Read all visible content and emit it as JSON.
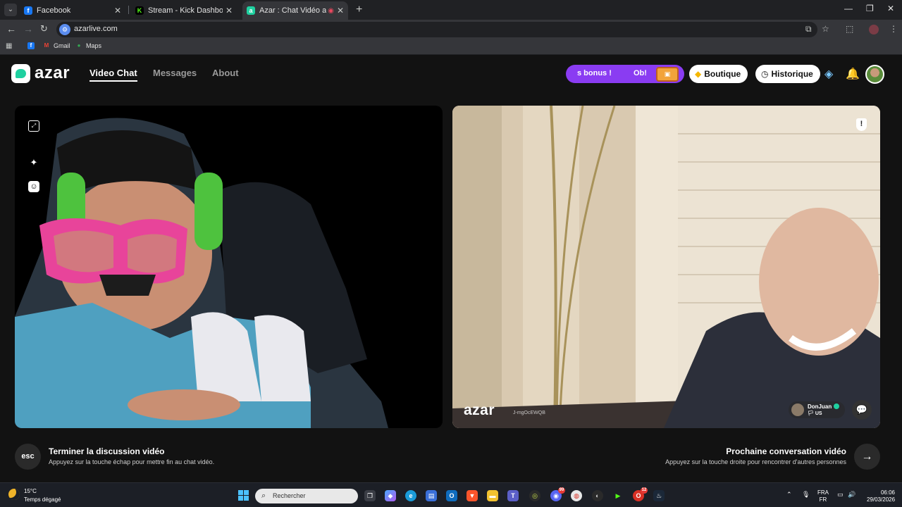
{
  "browser": {
    "tabs": [
      {
        "title": "Facebook",
        "icon": "facebook-icon",
        "color": "#1877f2",
        "glyph": "f"
      },
      {
        "title": "Stream - Kick Dashboard",
        "icon": "kick-icon",
        "color": "#53fc18",
        "glyph": "K"
      },
      {
        "title": "Azar : Chat Vidéo avec de n",
        "icon": "azar-icon",
        "color": "#1fd0a0",
        "glyph": "a"
      }
    ],
    "url": "azarlive.com",
    "bookmarks": [
      {
        "label": "",
        "icon": "facebook-icon",
        "color": "#1877f2",
        "glyph": "f"
      },
      {
        "label": "Gmail",
        "icon": "gmail-icon",
        "color": "#ea4335",
        "glyph": "M"
      },
      {
        "label": "Maps",
        "icon": "maps-icon",
        "color": "#34a853",
        "glyph": "●"
      }
    ]
  },
  "azar": {
    "logo": "azar",
    "nav": [
      "Video Chat",
      "Messages",
      "About"
    ],
    "bonus": {
      "text1": "s bonus !",
      "text2": "Ob!"
    },
    "shop_label": "Boutique",
    "history_label": "Historique",
    "peer": {
      "name": "DonJuan",
      "country": "US"
    },
    "watermark": "azar",
    "watermark_id": "J-mgOcEWQB",
    "esc_key": "esc",
    "end_title": "Terminer la discussion vidéo",
    "end_sub": "Appuyez sur la touche échap pour mettre fin au chat vidéo.",
    "next_title": "Prochaine conversation vidéo",
    "next_sub": "Appuyez sur la touche droite pour rencontrer d'autres personnes",
    "accent": "#1fd0a0",
    "bonus_color": "#8a3cf2"
  },
  "taskbar": {
    "temp": "15°C",
    "weather": "Temps dégagé",
    "search_placeholder": "Rechercher",
    "lang_top": "FRA",
    "lang_bottom": "FR",
    "time": "06:06",
    "date": "29/03/2026",
    "badges": {
      "discord": "99",
      "opera": "12"
    }
  }
}
